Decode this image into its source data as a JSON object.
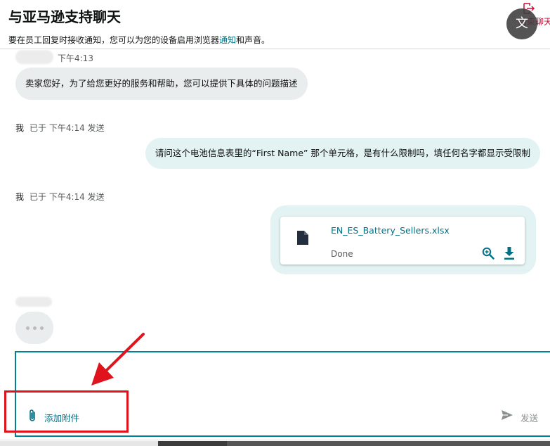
{
  "header": {
    "title": "与亚马逊支持聊天",
    "notice_prefix": "要在员工回复时接收通知，您可以为您的设备启用浏览器",
    "notice_link": "通知",
    "notice_suffix": "和声音。",
    "end_chat_label": "结束聊天",
    "translate_glyph": "文"
  },
  "messages": [
    {
      "sender": "agent",
      "time": "下午4:13",
      "text": "卖家您好，为了给您更好的服务和帮助，您可以提供下具体的问题描述"
    },
    {
      "sender": "me",
      "sender_label": "我",
      "status": "已于 下午4:14 发送",
      "text": "请问这个电池信息表里的“First Name” 那个单元格，是有什么限制吗，填任何名字都显示受限制"
    },
    {
      "sender": "me",
      "sender_label": "我",
      "status": "已于 下午4:14 发送",
      "attachment": {
        "file_name": "EN_ES_Battery_Sellers.xlsx",
        "status": "Done",
        "icons": [
          "file-icon",
          "zoom-icon",
          "download-icon"
        ]
      }
    }
  ],
  "typing_indicator": "agent-typing",
  "composer": {
    "attach_label": "添加附件",
    "send_label": "发送"
  },
  "colors": {
    "accent": "#008296",
    "link": "#007185",
    "agent_bubble": "#eaeded",
    "my_bubble": "#e3f2f2",
    "annotation": "#e0131d"
  }
}
